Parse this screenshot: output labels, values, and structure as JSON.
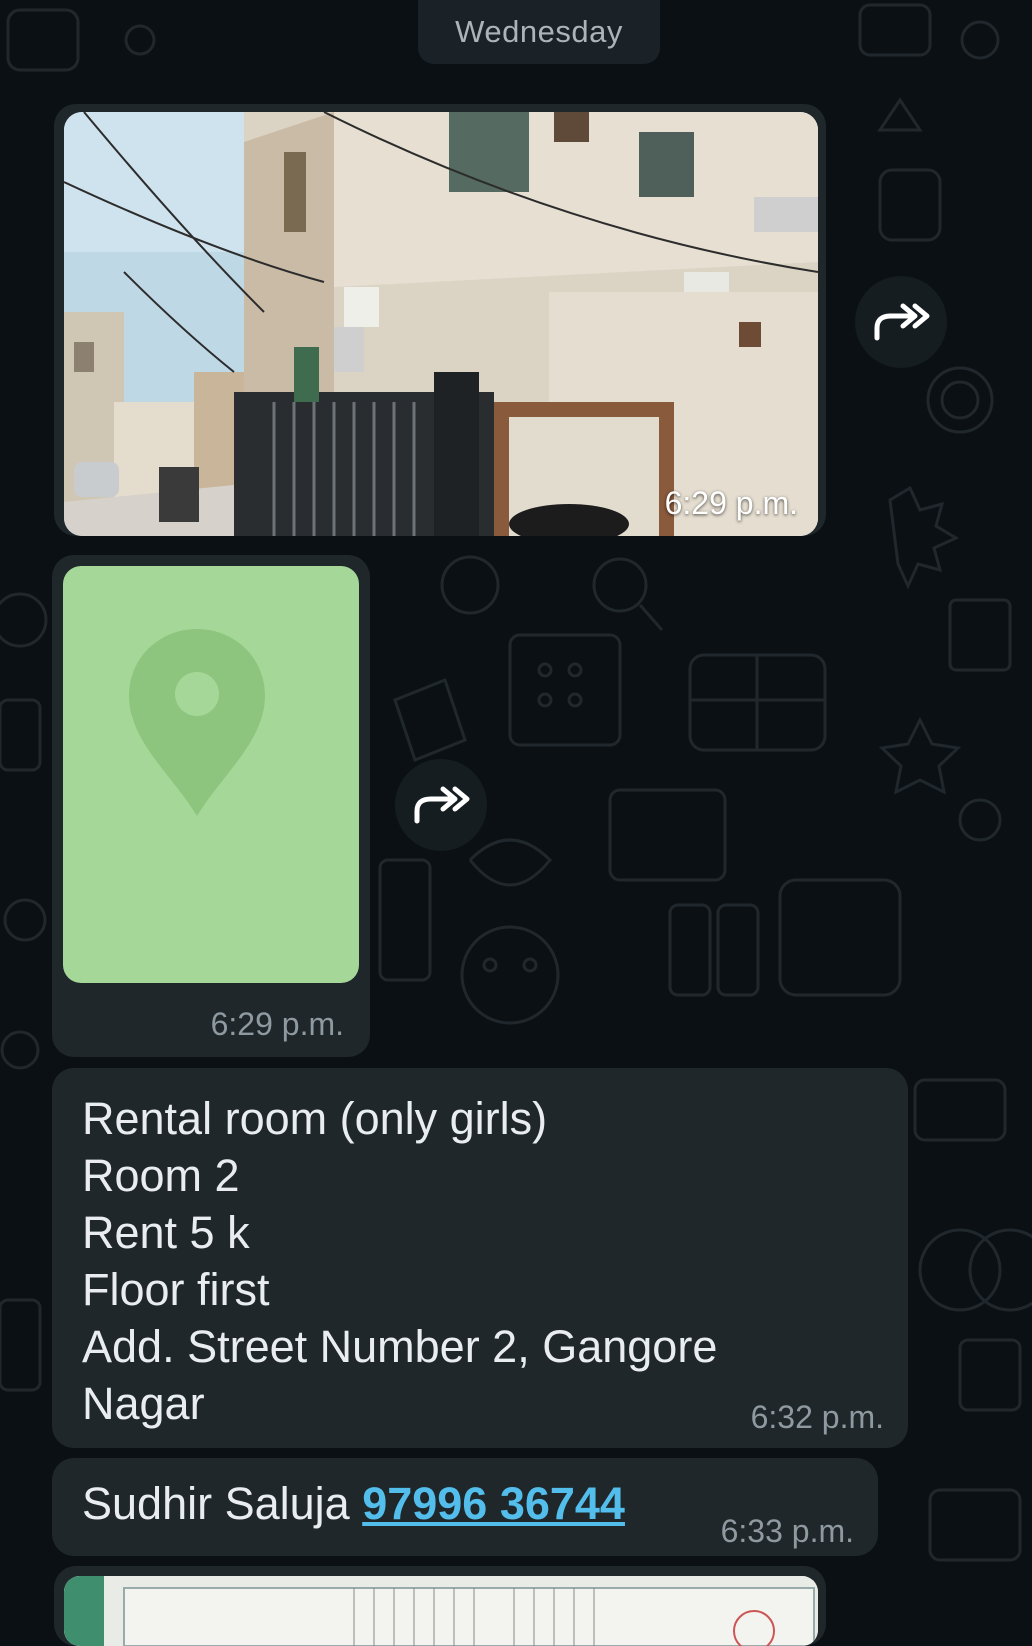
{
  "chat": {
    "date_separator": "Wednesday",
    "messages": [
      {
        "type": "image",
        "time": "6:29 p.m.",
        "forward_icon": "forward-icon"
      },
      {
        "type": "location",
        "time": "6:29 p.m.",
        "pin_icon": "location-pin-icon",
        "forward_icon": "forward-icon"
      },
      {
        "type": "text",
        "lines": [
          "Rental room (only girls)",
          "Room 2",
          "Rent 5 k",
          "Floor first",
          "Add. Street Number 2, Gangore",
          "Nagar"
        ],
        "time": "6:32 p.m."
      },
      {
        "type": "contact_text",
        "name": "Sudhir Saluja",
        "phone": "97996 36744",
        "time": "6:33 p.m."
      },
      {
        "type": "document_image"
      }
    ]
  },
  "colors": {
    "background": "#0b1014",
    "bubble": "#1f272b",
    "map": "#a5d898",
    "link": "#53bdeb",
    "timestamp": "#8e9aa0"
  }
}
